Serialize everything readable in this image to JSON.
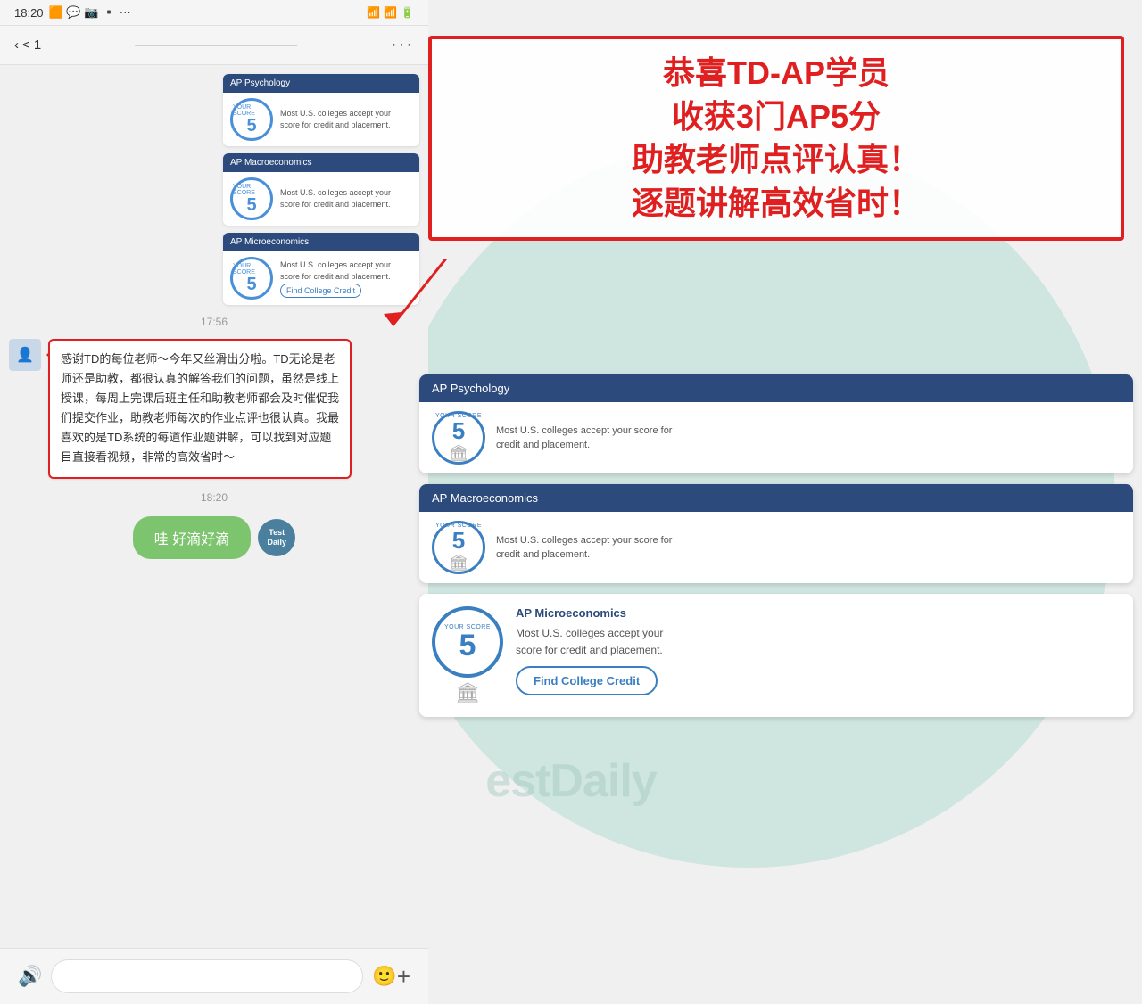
{
  "statusBar": {
    "time": "18:20",
    "signal": "WiFi",
    "battery": "🔋"
  },
  "nav": {
    "back": "< 1",
    "more": "···"
  },
  "cards": [
    {
      "subject": "AP Psychology",
      "scoreLabel": "YOUR SCORE",
      "score": "5",
      "description": "Most U.S. colleges accept your score for credit and placement."
    },
    {
      "subject": "AP Macroeconomics",
      "scoreLabel": "YOUR SCORE",
      "score": "5",
      "description": "Most U.S. colleges accept your score for credit and placement."
    }
  ],
  "thirdCard": {
    "subject": "AP Microeconomics",
    "scoreLabel": "YOUR SCORE",
    "score": "5",
    "description": "Most U.S. colleges accept your score for credit and placement.",
    "findCreditBtn": "Find College Credit"
  },
  "announcement": {
    "line1": "恭喜TD-AP学员",
    "line2": "收获3门AP5分",
    "line3": "助教老师点评认真！",
    "line4": "逐题讲解高效省时！"
  },
  "timestamps": {
    "t1": "17:56",
    "t2": "18:20"
  },
  "message": {
    "text": "感谢TD的每位老师～今年又丝滑出分啦。TD无论是老师还是助教，都很认真的解答我们的问题，虽然是线上授课，每周上完课后班主任和助教老师都会及时催促我们提交作业，助教老师每次的作业点评也很认真。我最喜欢的是TD系统的每道作业题讲解，可以找到对应题目直接看视频，非常的高效省时～"
  },
  "greenBubble": {
    "text": "哇 好滴好滴"
  },
  "watermark": "estDaily",
  "bottomBar": {
    "speakerIcon": "🔊",
    "emojiIcon": "🙂",
    "addIcon": "+"
  }
}
